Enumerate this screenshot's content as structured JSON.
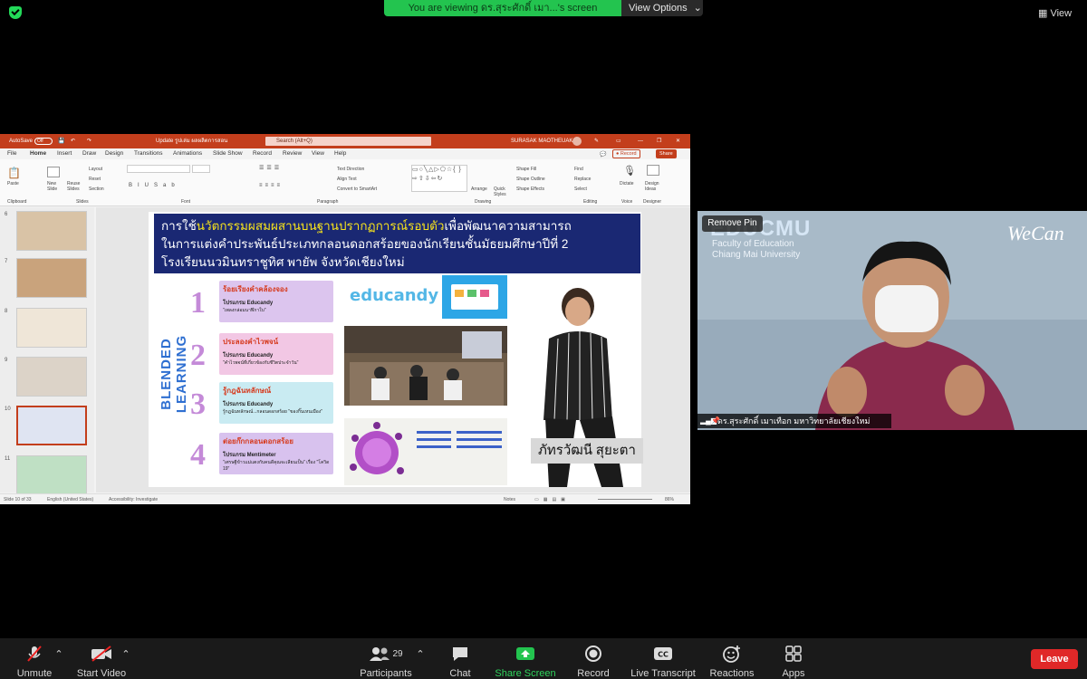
{
  "zoom": {
    "viewing_banner": "You are viewing ดร.สุระศักดิ์ เมา...'s screen",
    "view_options": "View Options",
    "view_button": "View",
    "remove_pin": "Remove Pin",
    "participant_name": "ดร.สุระศักดิ์ เมาเทือก มหาวิทยาลัยเชียงใหม่",
    "participants_count": "29",
    "toolbar": {
      "unmute": "Unmute",
      "start_video": "Start Video",
      "participants": "Participants",
      "chat": "Chat",
      "share_screen": "Share Screen",
      "record": "Record",
      "live_transcript": "Live Transcript",
      "reactions": "Reactions",
      "apps": "Apps",
      "leave": "Leave"
    },
    "colors": {
      "share_green": "#23c44f",
      "leave_red": "#e02828",
      "toolbar_bg": "#1a1a1a"
    }
  },
  "ppt": {
    "autosave": "AutoSave",
    "autosave_state": "Off",
    "doc_title": "Update รูปเล่ม ผลผลิตการสอน",
    "search_placeholder": "Search (Alt+Q)",
    "user": "SURASAK MAOTHEUAK",
    "menu": [
      "File",
      "Home",
      "Insert",
      "Draw",
      "Design",
      "Transitions",
      "Animations",
      "Slide Show",
      "Record",
      "Review",
      "View",
      "Help"
    ],
    "record_btn": "Record",
    "share_btn": "Share",
    "ribbon": {
      "paste": "Paste",
      "clipboard": "Clipboard",
      "new_slide": "New Slide",
      "reuse_slides": "Reuse Slides",
      "layout": "Layout",
      "reset": "Reset",
      "section": "Section",
      "slides": "Slides",
      "font": "Font",
      "paragraph": "Paragraph",
      "text_direction": "Text Direction",
      "align_text": "Align Text",
      "convert_smartart": "Convert to SmartArt",
      "arrange": "Arrange",
      "quick_styles": "Quick Styles",
      "shape_fill": "Shape Fill",
      "shape_outline": "Shape Outline",
      "shape_effects": "Shape Effects",
      "drawing": "Drawing",
      "find": "Find",
      "replace": "Replace",
      "select": "Select",
      "editing": "Editing",
      "dictate": "Dictate",
      "voice": "Voice",
      "design_ideas": "Design Ideas",
      "designer": "Designer"
    },
    "thumb_numbers": [
      "6",
      "7",
      "8",
      "9",
      "10",
      "11"
    ],
    "status": {
      "slide": "Slide 10 of 33",
      "language": "English (United States)",
      "accessibility": "Accessibility: Investigate",
      "notes": "Notes",
      "zoom": "86%"
    },
    "colors": {
      "titlebar": "#c33e1c",
      "slide_header": "#1a2873",
      "highlight": "#f6e21c"
    }
  },
  "slide": {
    "head_pre": "การใช้",
    "head_hl": "นวัตกรรมผสมผสานบนฐานปรากฏการณ์รอบตัว",
    "head_post": "เพื่อพัฒนาความสามารถ",
    "head_line2": "ในการแต่งคำประพันธ์ประเภทกลอนดอกสร้อยของนักเรียนชั้นมัธยมศึกษาปีที่ 2",
    "head_line3": "โรงเรียนนวมินทราชูทิศ พายัพ จังหวัดเชียงใหม่",
    "vertical": "BLENDED LEARNING",
    "steps": [
      {
        "num": "1",
        "title": "ร้อยเรียงคำคล้องจอง",
        "program": "โปรแกรม Educandy",
        "note": "\"เพลงกล่อมนาฬิกาใบ\""
      },
      {
        "num": "2",
        "title": "ประลองคำไวพจน์",
        "program": "โปรแกรม Educandy",
        "note": "\"คำไวพจน์ที่เกี่ยวข้องกับชีวิตประจำวัน\""
      },
      {
        "num": "3",
        "title": "รู้กฎฉันทลักษณ์",
        "program": "โปรแกรม Educandy",
        "note": "รู้กฎฉันทลักษณ์...กลอนดอกสร้อย \"ของกิ๊นเหนเมือง\""
      },
      {
        "num": "4",
        "title": "ต่อยก๊กกลอนดอกสร้อย",
        "program": "โปรแกรม Mentimeter",
        "note": "\"เศรษฐีข้าวแม่แตงกับคนดีคุณจะเลียนเป็น\" เรื่อง \"โควิด 19\""
      }
    ],
    "educandy_logo": "educandy",
    "student_name": "ภัทรวัฒนี สุยะตา"
  },
  "cam": {
    "logo_line1": "EDUCMU",
    "logo_line2": "Faculty of Education",
    "logo_line3": "Chiang Mai University",
    "brand": "WeCan"
  }
}
